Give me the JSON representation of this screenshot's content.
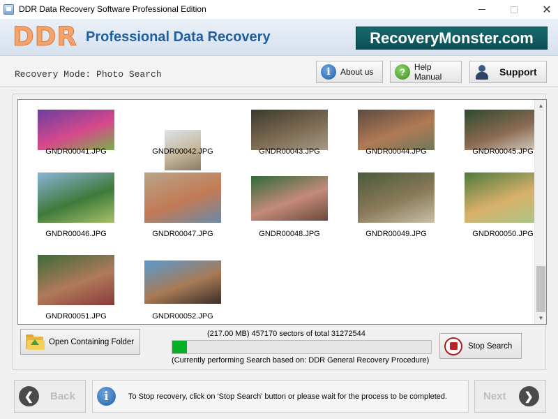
{
  "window": {
    "title": "DDR Data Recovery Software Professional Edition"
  },
  "banner": {
    "logo": "DDR",
    "title": "Professional Data Recovery",
    "brand": "RecoveryMonster.com"
  },
  "toolbar": {
    "mode": "Recovery Mode: Photo Search",
    "about_label": "About us",
    "help_label": "Help Manual",
    "support_label": "Support"
  },
  "gallery": {
    "items": [
      {
        "name": "GNDR00041.JPG",
        "colors": [
          "#6b3fa0",
          "#d6498c",
          "#7bb04a"
        ]
      },
      {
        "name": "GNDR00042.JPG",
        "colors": [
          "#dbe3ea",
          "#c7b79c",
          "#8a7a66"
        ]
      },
      {
        "name": "GNDR00043.JPG",
        "colors": [
          "#3a3a2c",
          "#7d6a52",
          "#a49a86"
        ]
      },
      {
        "name": "GNDR00044.JPG",
        "colors": [
          "#5c4a3e",
          "#b07a55",
          "#6e7a5a"
        ]
      },
      {
        "name": "GNDR00045.JPG",
        "colors": [
          "#2e4a2e",
          "#8a6a52",
          "#d8cfc4"
        ]
      },
      {
        "name": "GNDR00046.JPG",
        "colors": [
          "#8bb4d8",
          "#3e7a3a",
          "#a8c06a"
        ]
      },
      {
        "name": "GNDR00047.JPG",
        "colors": [
          "#b9a488",
          "#c27a55",
          "#6a8aa8"
        ]
      },
      {
        "name": "GNDR00048.JPG",
        "colors": [
          "#2f6a3a",
          "#c48a7a",
          "#6a4a3a"
        ]
      },
      {
        "name": "GNDR00049.JPG",
        "colors": [
          "#4a5a3a",
          "#8a7a5a",
          "#c8c0a8"
        ]
      },
      {
        "name": "GNDR00050.JPG",
        "colors": [
          "#4e7a3e",
          "#d8b06a",
          "#a8c888"
        ]
      },
      {
        "name": "GNDR00051.JPG",
        "colors": [
          "#3e6a3a",
          "#b07a5a",
          "#8a3a3a"
        ]
      },
      {
        "name": "GNDR00052.JPG",
        "colors": [
          "#5a9ad0",
          "#a87a55",
          "#3a2e2a"
        ]
      }
    ]
  },
  "open_folder_label": "Open Containing Folder",
  "progress": {
    "sectors_text": "(217.00 MB) 457170  sectors  of  total 31272544",
    "fraction": 0.0146,
    "status": "(Currently performing Search based on:  DDR General Recovery Procedure)"
  },
  "stop_label": "Stop Search",
  "footer": {
    "back_label": "Back",
    "next_label": "Next",
    "info": "To Stop recovery, click on 'Stop Search' button or please wait for the process to be completed."
  }
}
